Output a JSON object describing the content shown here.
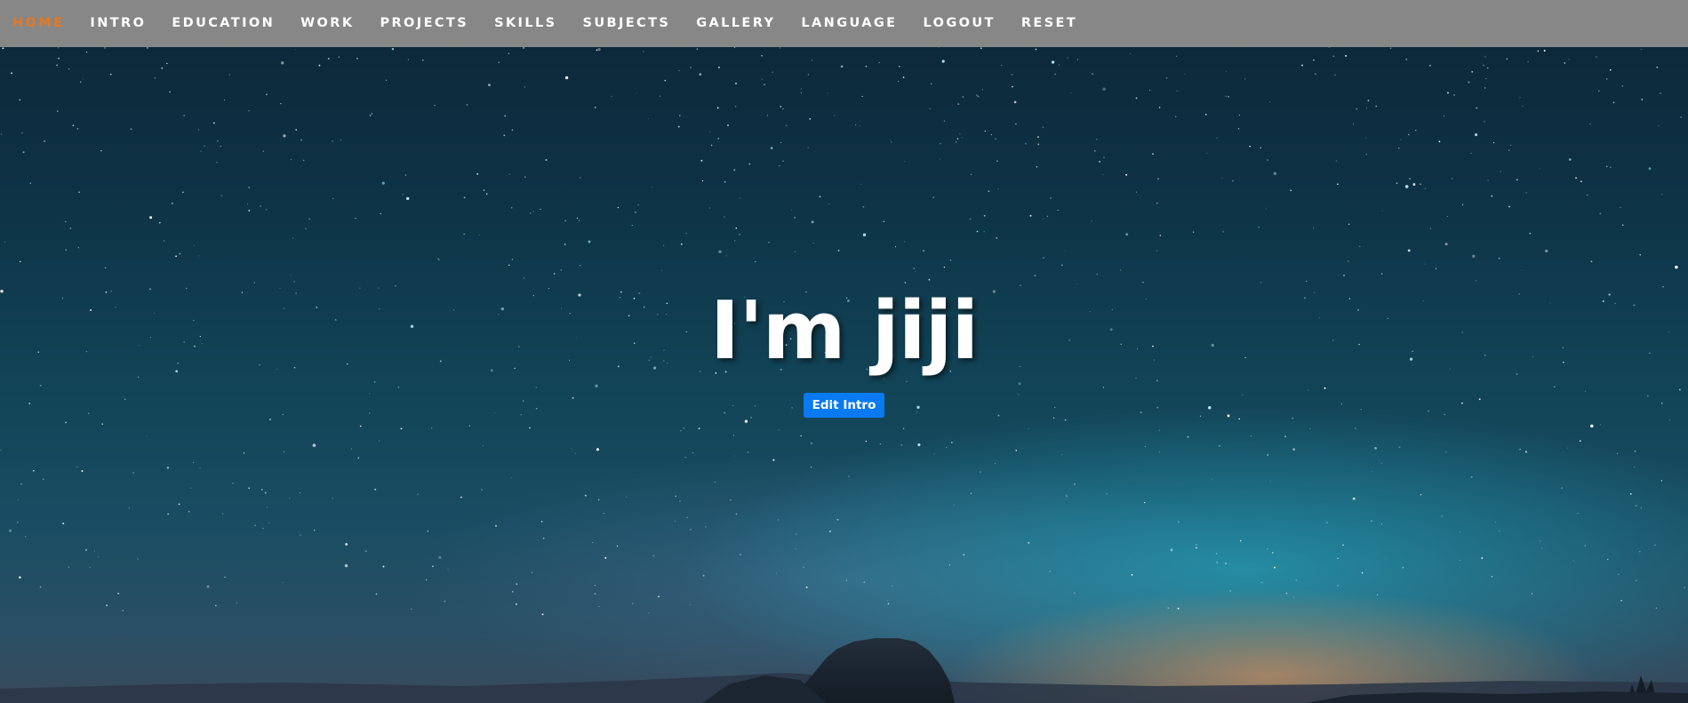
{
  "nav": {
    "items": [
      {
        "label": "HOME",
        "active": true
      },
      {
        "label": "INTRO",
        "active": false
      },
      {
        "label": "EDUCATION",
        "active": false
      },
      {
        "label": "WORK",
        "active": false
      },
      {
        "label": "PROJECTS",
        "active": false
      },
      {
        "label": "SKILLS",
        "active": false
      },
      {
        "label": "SUBJECTS",
        "active": false
      },
      {
        "label": "GALLERY",
        "active": false
      },
      {
        "label": "LANGUAGE",
        "active": false
      },
      {
        "label": "LOGOUT",
        "active": false
      },
      {
        "label": "RESET",
        "active": false
      }
    ],
    "background_color": "#878787",
    "active_color": "#e8781f",
    "text_color": "#ffffff"
  },
  "banner": {
    "headline": "I'm jiji",
    "edit_button_label": "Edit Intro",
    "button_color": "#0a7af2",
    "background": "night sky with stars over mountain silhouette"
  }
}
